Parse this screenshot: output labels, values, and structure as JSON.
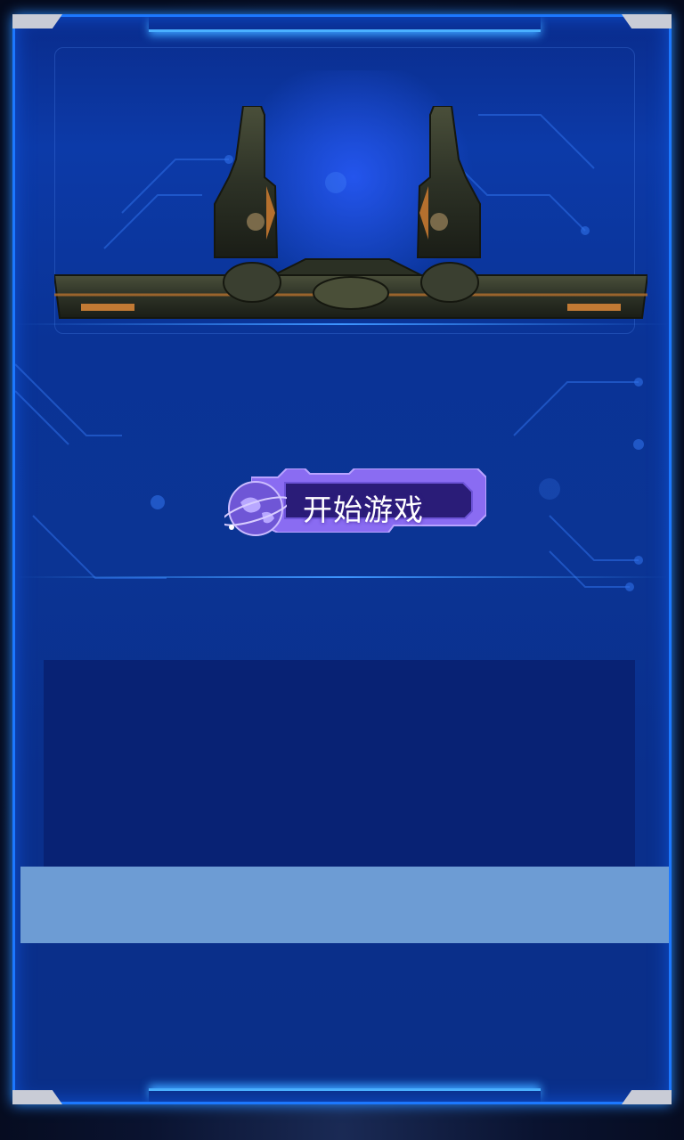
{
  "screen": {
    "start_button": {
      "label": "开始游戏",
      "icon": "globe-icon"
    }
  },
  "colors": {
    "frame_border": "#1c78ff",
    "panel_blue": "#0b3494",
    "button_purple": "#8a6cf2",
    "strip": "#6d9cd4"
  }
}
